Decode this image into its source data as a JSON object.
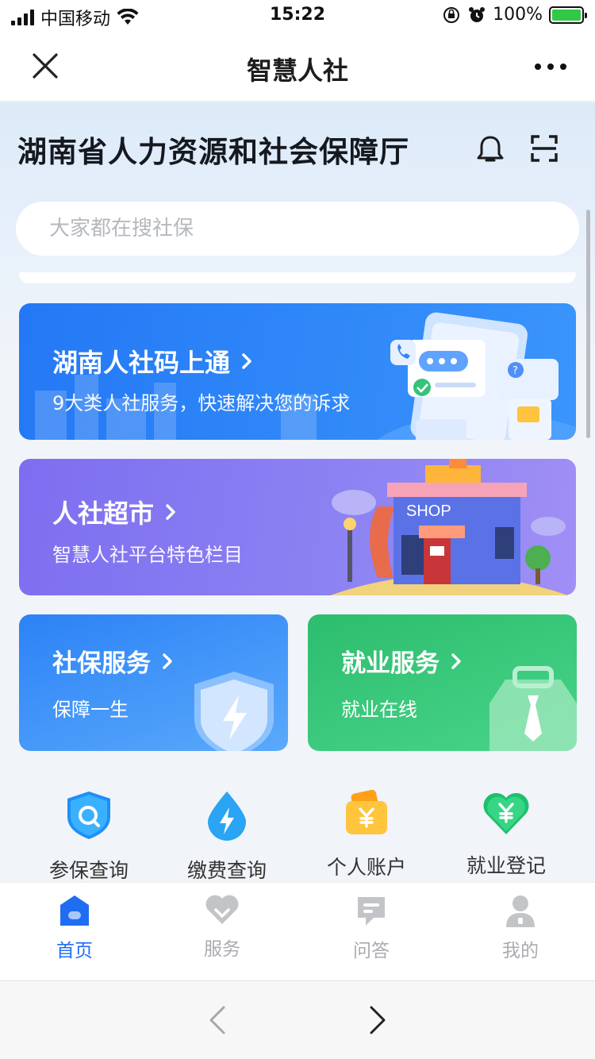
{
  "status_bar": {
    "carrier": "中国移动",
    "time": "15:22",
    "battery": "100%",
    "battery_level": 1.0
  },
  "nav": {
    "title": "智慧人社",
    "close_icon": "close-icon",
    "more_icon": "more-icon"
  },
  "header": {
    "org_title": "湖南省人力资源和社会保障厅",
    "bell_icon": "bell-icon",
    "scan_icon": "scan-icon"
  },
  "search": {
    "placeholder": "大家都在搜社保"
  },
  "banners": [
    {
      "title": "湖南人社码上通",
      "subtitle": "9大类人社服务，快速解决您的诉求",
      "color": "#2478f5"
    },
    {
      "title": "人社超市",
      "subtitle": "智慧人社平台特色栏目",
      "shop_sign": "SHOP",
      "color": "#7d6ef0"
    }
  ],
  "cards": [
    {
      "title": "社保服务",
      "subtitle": "保障一生",
      "color": "#2c82f6"
    },
    {
      "title": "就业服务",
      "subtitle": "就业在线",
      "color": "#2dbd6e"
    }
  ],
  "quick_links": [
    {
      "label": "参保查询",
      "icon": "shield-search-icon"
    },
    {
      "label": "缴费查询",
      "icon": "drop-bolt-icon"
    },
    {
      "label": "个人账户",
      "icon": "wallet-yuan-icon"
    },
    {
      "label": "就业登记",
      "icon": "heart-yuan-icon"
    }
  ],
  "tabs": [
    {
      "label": "首页",
      "icon": "home-icon",
      "active": true
    },
    {
      "label": "服务",
      "icon": "heart-icon",
      "active": false
    },
    {
      "label": "问答",
      "icon": "chat-icon",
      "active": false
    },
    {
      "label": "我的",
      "icon": "user-icon",
      "active": false
    }
  ],
  "colors": {
    "accent": "#1f6df2",
    "inactive_tab": "#a9abb0"
  }
}
